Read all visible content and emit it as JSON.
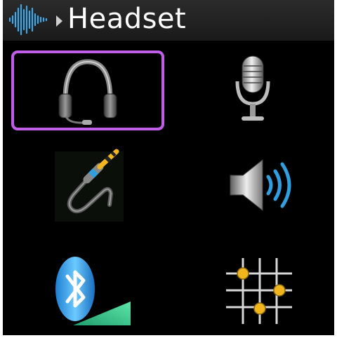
{
  "header": {
    "icon": "waveform-icon",
    "arrow_icon": "right-arrow-icon",
    "title": "Headset"
  },
  "menu": {
    "selected": "headset",
    "items": [
      {
        "id": "headset",
        "icon": "headset-icon",
        "selected": true
      },
      {
        "id": "microphone",
        "icon": "microphone-icon",
        "selected": false
      },
      {
        "id": "audio-cable",
        "icon": "audio-jack-icon",
        "selected": false
      },
      {
        "id": "speaker",
        "icon": "speaker-icon",
        "selected": false
      },
      {
        "id": "bluetooth",
        "icon": "bluetooth-icon",
        "selected": false
      },
      {
        "id": "settings-grid",
        "icon": "grid-settings-icon",
        "selected": false
      }
    ]
  },
  "colors": {
    "selection_border": "#c05ee8",
    "accent_blue": "#2f9fe0",
    "accent_gold": "#f2b51e",
    "accent_green": "#34c98a"
  }
}
